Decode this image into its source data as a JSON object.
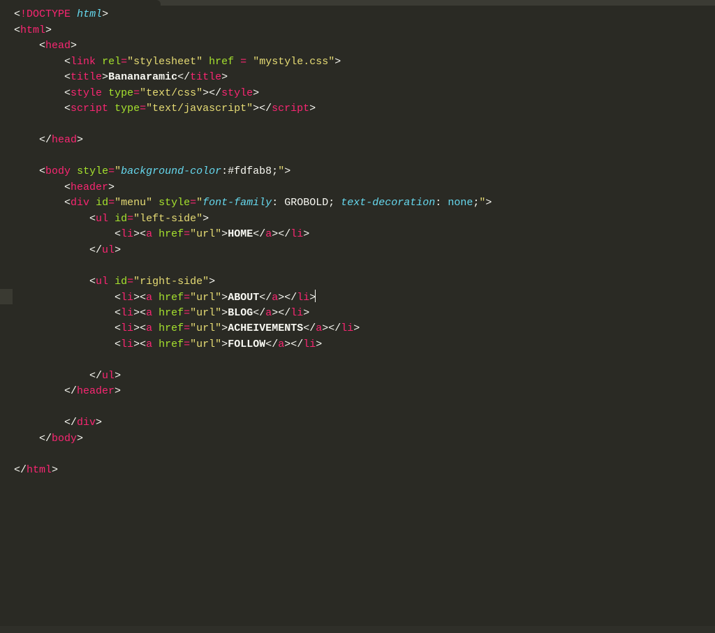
{
  "editor": {
    "theme": "monokai",
    "language": "html"
  },
  "t": {
    "lt": "<",
    "gt": ">",
    "ltsl": "</",
    "excl": "!",
    "eq": "=",
    "sp": " ",
    "colon": ":",
    "semicolon": ";"
  },
  "tags": {
    "doctype": "DOCTYPE",
    "html": "html",
    "head": "head",
    "link": "link",
    "title": "title",
    "style": "style",
    "script": "script",
    "body": "body",
    "header": "header",
    "div": "div",
    "ul": "ul",
    "li": "li",
    "a": "a"
  },
  "attrs": {
    "rel": "rel",
    "href": "href",
    "type": "type",
    "style": "style",
    "id": "id"
  },
  "strings": {
    "stylesheet": "\"stylesheet\"",
    "mystyle": "\"mystyle.css\"",
    "textcss": "\"text/css\"",
    "textjs": "\"text/javascript\"",
    "menu": "\"menu\"",
    "leftside": "\"left-side\"",
    "rightside": "\"right-side\"",
    "url": "\"url\"",
    "q": "\""
  },
  "css": {
    "bgcolor_prop": "background-color",
    "bgcolor_val": "#fdfab8",
    "ff_prop": "font-family",
    "ff_val": " GROBOLD",
    "td_prop": "text-decoration",
    "td_val": "none"
  },
  "content": {
    "title": "Bananaramic",
    "home": "HOME",
    "about": "ABOUT",
    "blog": "BLOG",
    "ach": "ACHEIVEMENTS",
    "follow": "FOLLOW"
  },
  "indent": {
    "i0": "",
    "i1": "    ",
    "i2": "        ",
    "i3": "            ",
    "i4": "                "
  }
}
